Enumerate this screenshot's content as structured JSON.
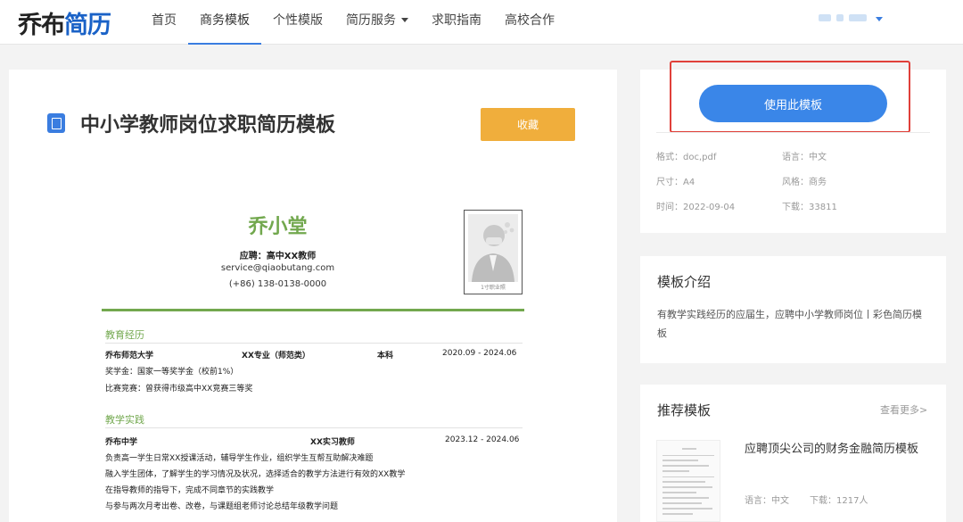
{
  "header": {
    "logo_main": "乔布",
    "logo_accent": "简历",
    "nav": [
      "首页",
      "商务模板",
      "个性模版",
      "简历服务",
      "求职指南",
      "高校合作"
    ],
    "active_nav": "商务模板"
  },
  "template": {
    "title": "中小学教师岗位求职简历模板",
    "favorite_label": "收藏"
  },
  "resume": {
    "name": "乔小堂",
    "job": "应聘：高中XX教师",
    "email": "service@qiaobutang.com",
    "phone": "(+86) 138-0138-0000",
    "photo_caption": "1寸职业照",
    "sections": {
      "education": {
        "title": "教育经历",
        "school": "乔布师范大学",
        "major": "XX专业（师范类）",
        "degree": "本科",
        "period": "2020.09 - 2024.06",
        "line1": "奖学金：国家一等奖学金（校前1%）",
        "line2": "比赛竞赛：曾获得市级高中XX竞赛三等奖"
      },
      "practice": {
        "title": "教学实践",
        "school": "乔布中学",
        "role": "XX实习教师",
        "period": "2023.12 - 2024.06",
        "lines": [
          "负责高一学生日常XX授课活动，辅导学生作业，组织学生互帮互助解决难题",
          "融入学生团体，了解学生的学习情况及状况，选择适合的教学方法进行有效的XX教学",
          "在指导教师的指导下，完成不同章节的实践教学",
          "与参与两次月考出卷、改卷，与课题组老师讨论总结年级教学问题"
        ]
      }
    }
  },
  "sidebar": {
    "use_button": "使用此模板",
    "meta": {
      "format": "格式：doc,pdf",
      "language": "语言：中文",
      "size": "尺寸：A4",
      "style": "风格：商务",
      "date": "时间：2022-09-04",
      "downloads": "下载：33811"
    },
    "intro_title": "模板介绍",
    "intro_text": "有教学实践经历的应届生，应聘中小学教师岗位丨彩色简历模板",
    "recommend_title": "推荐模板",
    "more_label": "查看更多>",
    "recommend_item": {
      "title": "应聘顶尖公司的财务金融简历模板",
      "language": "语言：中文",
      "downloads": "下载：1217人"
    }
  },
  "colors": {
    "accent_blue": "#3a86e8",
    "resume_green": "#72a84e",
    "favorite_orange": "#f0ae3c",
    "highlight_red": "#e0403a"
  }
}
